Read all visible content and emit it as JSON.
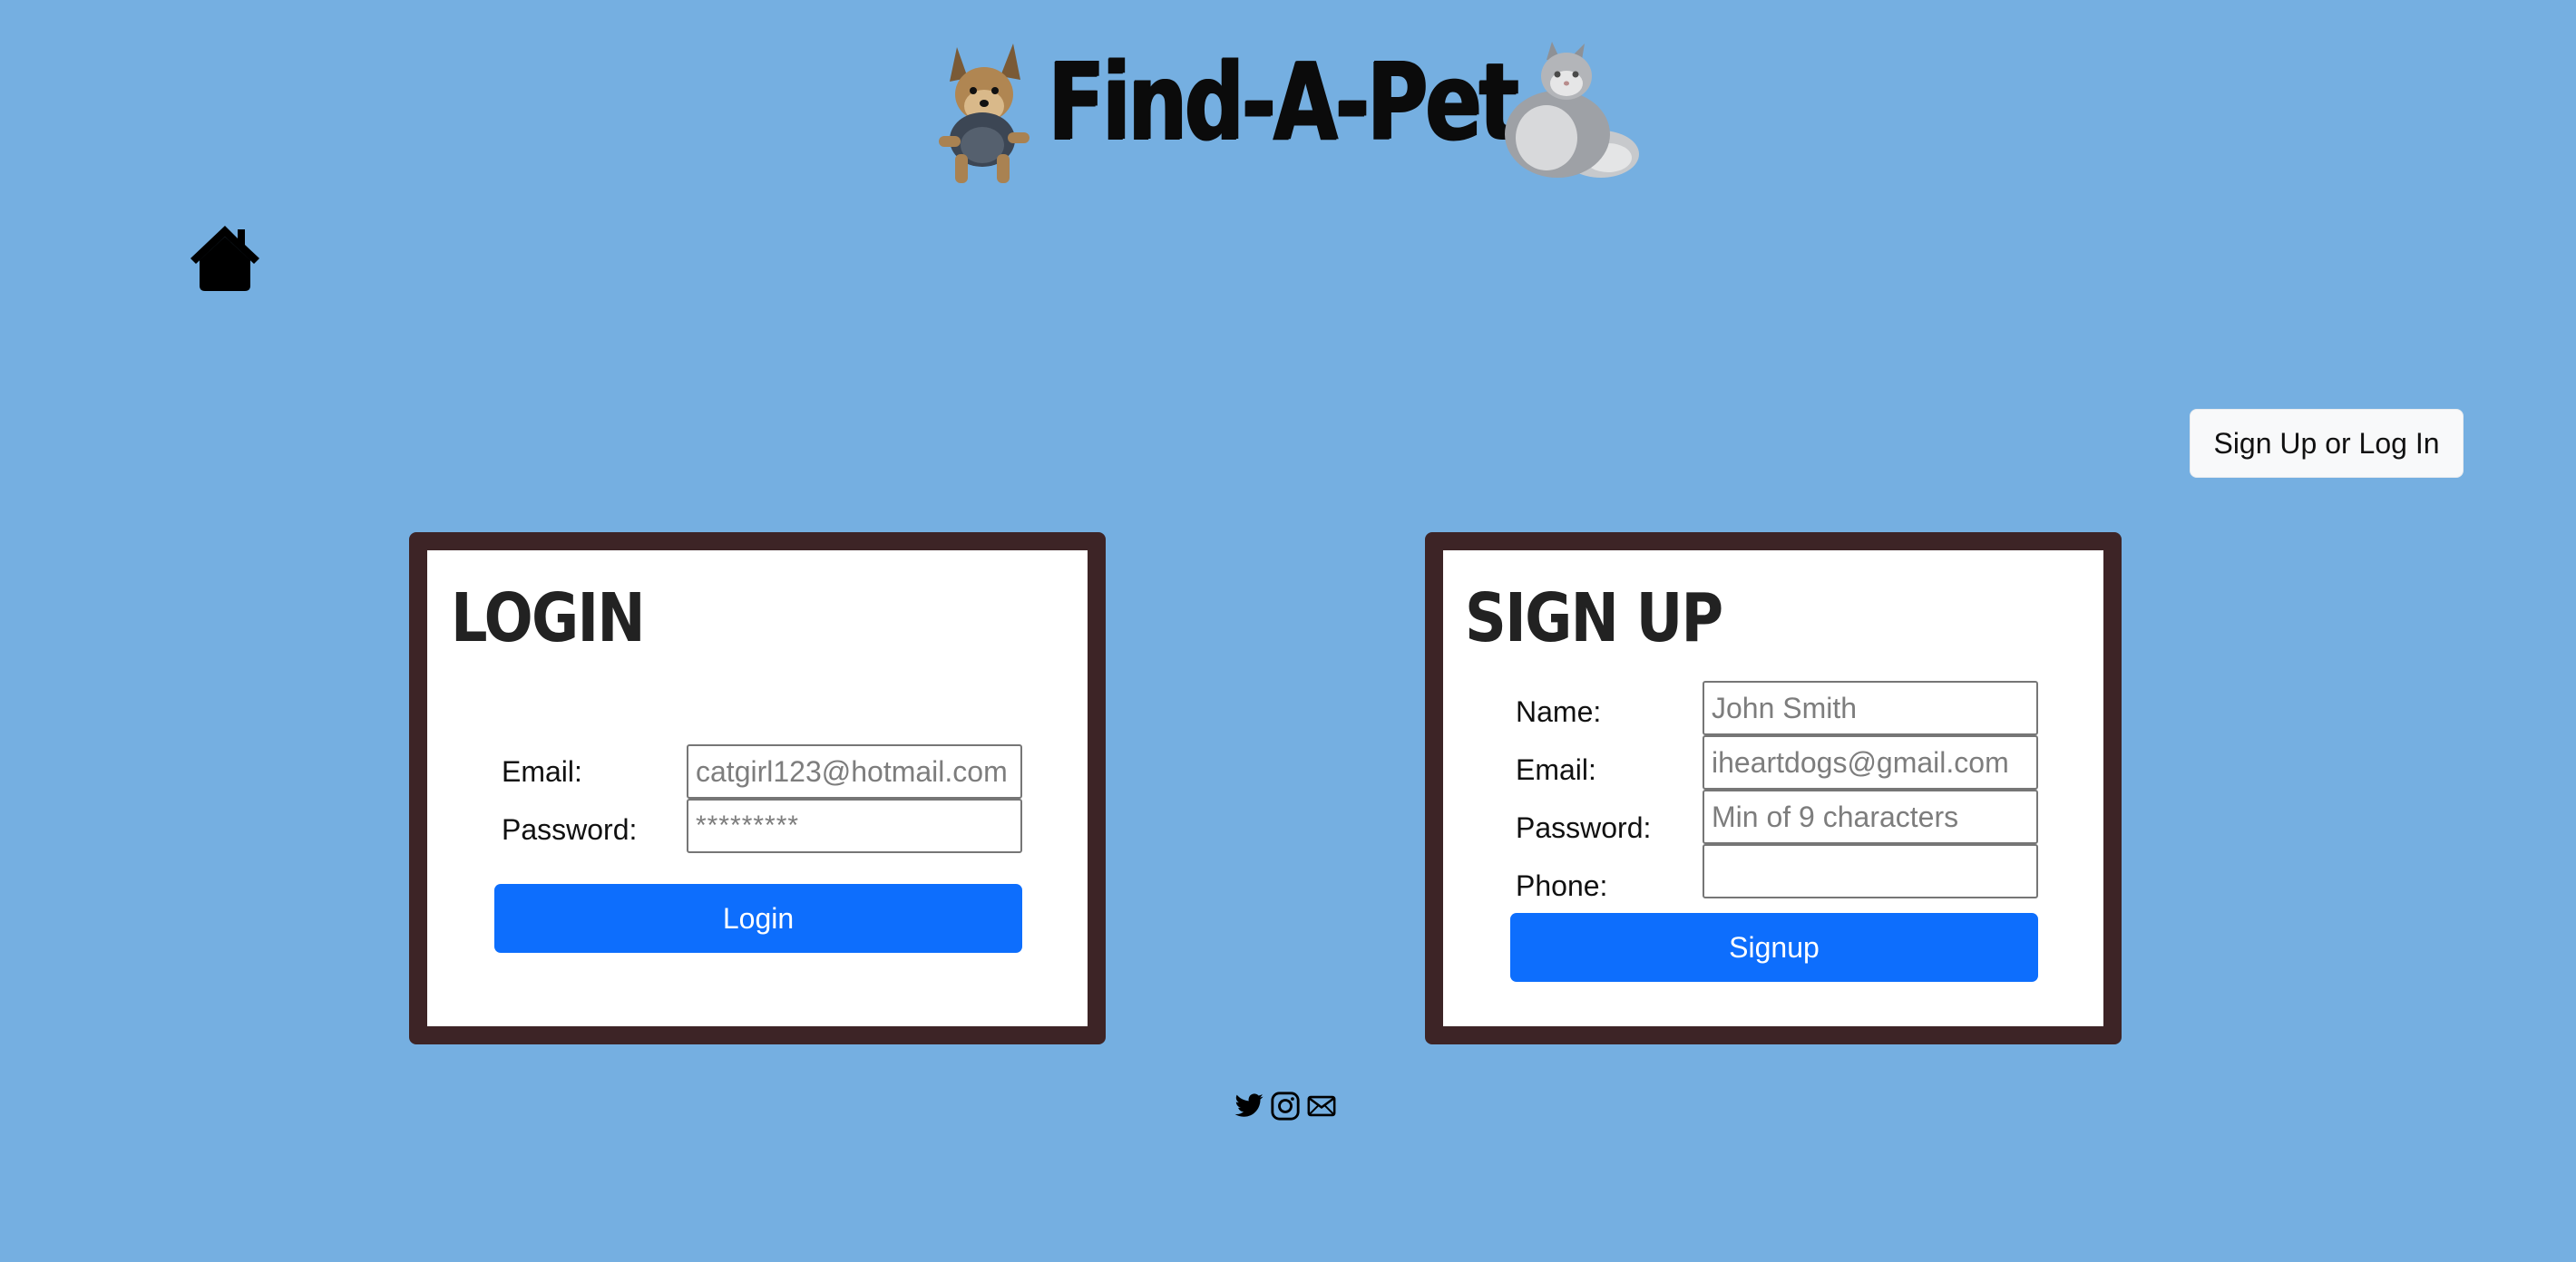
{
  "header": {
    "title": "Find-A-Pet",
    "dog_image_alt": "dog",
    "cat_image_alt": "cat"
  },
  "nav": {
    "home_icon": "home-icon",
    "auth_button_label": "Sign Up or Log In"
  },
  "login": {
    "heading": "LOGIN",
    "email_label": "Email:",
    "email_placeholder": "catgirl123@hotmail.com",
    "password_label": "Password:",
    "password_placeholder": "*********",
    "submit_label": "Login"
  },
  "signup": {
    "heading": "SIGN UP",
    "name_label": "Name:",
    "name_placeholder": "John Smith",
    "email_label": "Email:",
    "email_placeholder": "iheartdogs@gmail.com",
    "password_label": "Password:",
    "password_placeholder": "Min of 9 characters",
    "phone_label": "Phone:",
    "phone_placeholder": "",
    "submit_label": "Signup"
  },
  "footer": {
    "icons": [
      "twitter-icon",
      "instagram-icon",
      "envelope-icon"
    ]
  },
  "colors": {
    "background": "#75afe1",
    "card_border": "#3d2426",
    "primary": "#0d6efd"
  }
}
